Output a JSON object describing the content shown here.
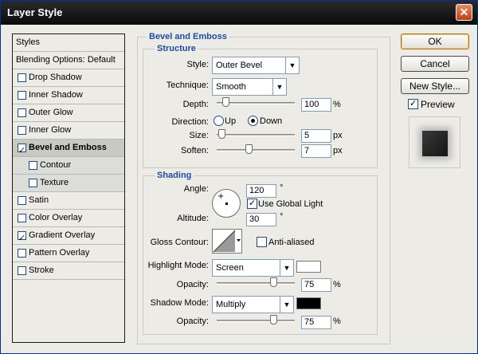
{
  "window": {
    "title": "Layer Style"
  },
  "styles_list": {
    "items": [
      {
        "label": "Styles",
        "kind": "header",
        "checked": false
      },
      {
        "label": "Blending Options: Default",
        "kind": "header",
        "checked": false
      },
      {
        "label": "Drop Shadow",
        "kind": "check",
        "checked": false
      },
      {
        "label": "Inner Shadow",
        "kind": "check",
        "checked": false
      },
      {
        "label": "Outer Glow",
        "kind": "check",
        "checked": false
      },
      {
        "label": "Inner Glow",
        "kind": "check",
        "checked": false
      },
      {
        "label": "Bevel and Emboss",
        "kind": "check",
        "checked": true,
        "selected": true
      },
      {
        "label": "Contour",
        "kind": "sub",
        "checked": false
      },
      {
        "label": "Texture",
        "kind": "sub",
        "checked": false
      },
      {
        "label": "Satin",
        "kind": "check",
        "checked": false
      },
      {
        "label": "Color Overlay",
        "kind": "check",
        "checked": false
      },
      {
        "label": "Gradient Overlay",
        "kind": "check",
        "checked": true
      },
      {
        "label": "Pattern Overlay",
        "kind": "check",
        "checked": false
      },
      {
        "label": "Stroke",
        "kind": "check",
        "checked": false
      }
    ]
  },
  "bevel": {
    "title": "Bevel and Emboss",
    "structure": {
      "title": "Structure",
      "style_label": "Style:",
      "style_value": "Outer Bevel",
      "technique_label": "Technique:",
      "technique_value": "Smooth",
      "depth_label": "Depth:",
      "depth_value": "100",
      "depth_unit": "%",
      "direction_label": "Direction:",
      "direction_up": "Up",
      "direction_down": "Down",
      "direction_selected": "Down",
      "size_label": "Size:",
      "size_value": "5",
      "size_unit": "px",
      "soften_label": "Soften:",
      "soften_value": "7",
      "soften_unit": "px"
    },
    "shading": {
      "title": "Shading",
      "angle_label": "Angle:",
      "angle_value": "120",
      "angle_unit": "°",
      "global_light_label": "Use Global Light",
      "global_light_checked": true,
      "altitude_label": "Altitude:",
      "altitude_value": "30",
      "altitude_unit": "°",
      "gloss_label": "Gloss Contour:",
      "antialiased_label": "Anti-aliased",
      "antialiased_checked": false,
      "highlight_mode_label": "Highlight Mode:",
      "highlight_mode_value": "Screen",
      "highlight_color": "#ffffff",
      "highlight_opacity_label": "Opacity:",
      "highlight_opacity_value": "75",
      "highlight_opacity_unit": "%",
      "shadow_mode_label": "Shadow Mode:",
      "shadow_mode_value": "Multiply",
      "shadow_color": "#000000",
      "shadow_opacity_label": "Opacity:",
      "shadow_opacity_value": "75",
      "shadow_opacity_unit": "%"
    }
  },
  "buttons": {
    "ok": "OK",
    "cancel": "Cancel",
    "new_style": "New Style...",
    "preview_label": "Preview",
    "preview_checked": true
  },
  "sliders": {
    "depth": 0.08,
    "size": 0.02,
    "soften": 0.4,
    "highlight_opacity": 0.75,
    "shadow_opacity": 0.75
  }
}
